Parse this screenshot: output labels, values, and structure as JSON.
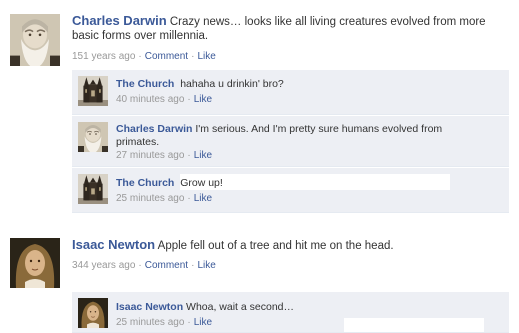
{
  "posts": [
    {
      "author": "Charles Darwin",
      "text": "Crazy news… looks like all living creatures evolved from more basic forms over millennia.",
      "time": "151 years ago",
      "comment_link": "Comment",
      "like_link": "Like",
      "comments": [
        {
          "author": "The Church",
          "text": "hahaha u drinkin' bro?",
          "time": "40 minutes ago",
          "like_link": "Like",
          "avatar_icon": "church-icon"
        },
        {
          "author": "Charles Darwin",
          "text": "I'm serious.  And I'm pretty sure humans evolved from primates.",
          "time": "27 minutes ago",
          "like_link": "Like",
          "avatar_icon": "darwin-portrait-icon"
        },
        {
          "author": "The Church",
          "text": "Grow up!",
          "time": "25 minutes ago",
          "like_link": "Like",
          "avatar_icon": "church-icon"
        }
      ]
    },
    {
      "author": "Isaac Newton",
      "text": "Apple fell out of a tree and hit me on the head.",
      "time": "344 years ago",
      "comment_link": "Comment",
      "like_link": "Like",
      "comments": [
        {
          "author": "Isaac Newton",
          "text": "Whoa, wait a second…",
          "time": "25 minutes ago",
          "like_link": "Like",
          "avatar_icon": "newton-portrait-icon"
        }
      ]
    }
  ],
  "separator": "·",
  "colors": {
    "link": "#3b5998",
    "comment_bg": "#edeff4",
    "meta": "#999999"
  }
}
